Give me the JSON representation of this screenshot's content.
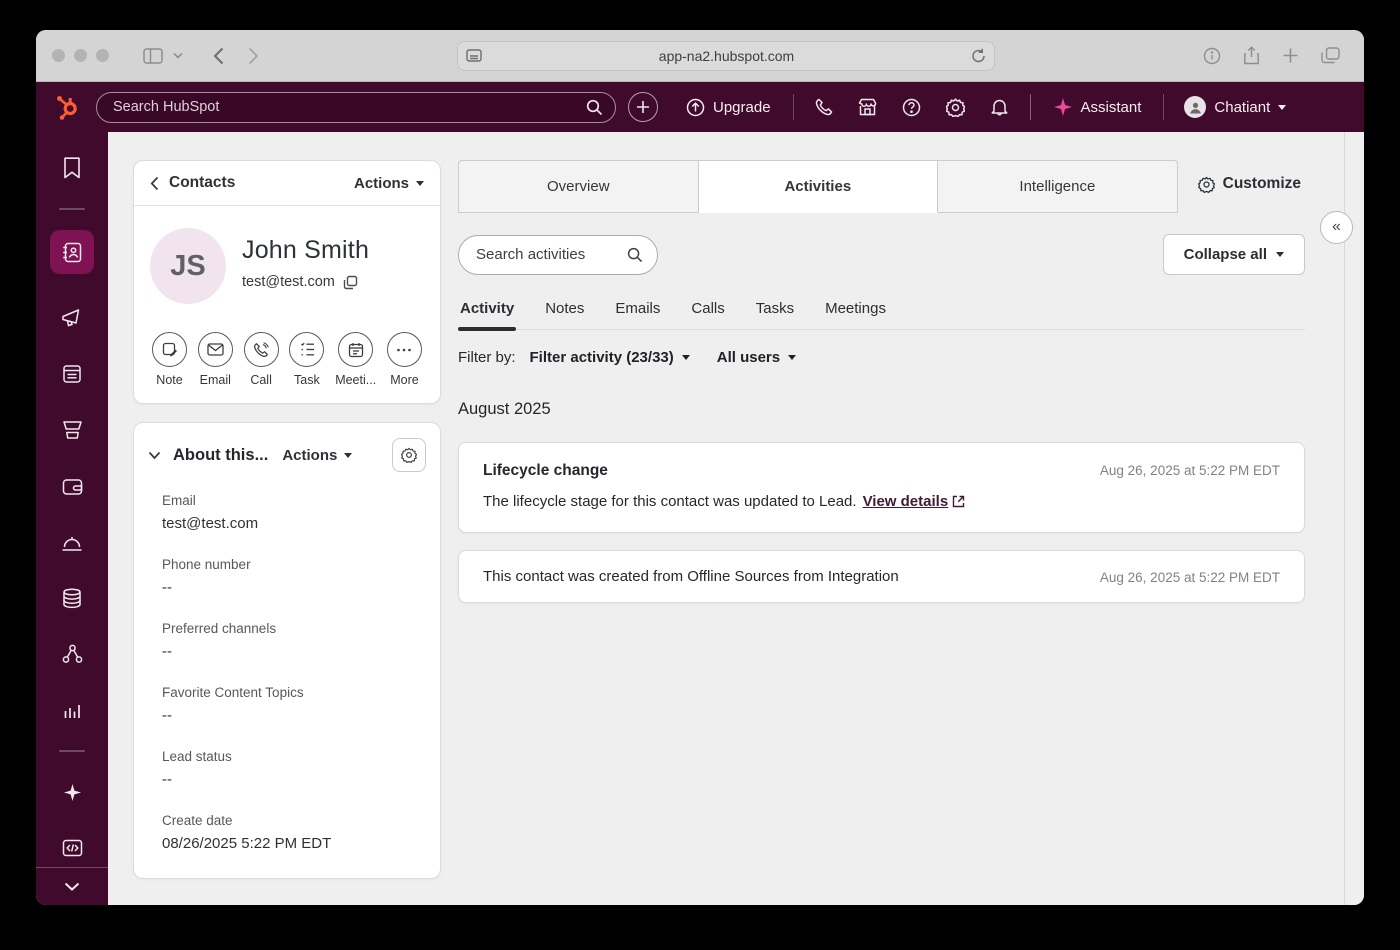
{
  "browser": {
    "url": "app-na2.hubspot.com"
  },
  "topnav": {
    "search_placeholder": "Search HubSpot",
    "upgrade_label": "Upgrade",
    "assistant_label": "Assistant",
    "user_name": "Chatiant"
  },
  "contact_panel": {
    "back_label": "Contacts",
    "actions_label": "Actions",
    "initials": "JS",
    "name": "John Smith",
    "email": "test@test.com",
    "quick_actions": [
      {
        "label": "Note"
      },
      {
        "label": "Email"
      },
      {
        "label": "Call"
      },
      {
        "label": "Task"
      },
      {
        "label": "Meeti..."
      },
      {
        "label": "More"
      }
    ]
  },
  "about_panel": {
    "title": "About this...",
    "actions_label": "Actions",
    "fields": [
      {
        "label": "Email",
        "value": "test@test.com"
      },
      {
        "label": "Phone number",
        "value": "--"
      },
      {
        "label": "Preferred channels",
        "value": "--"
      },
      {
        "label": "Favorite Content Topics",
        "value": "--"
      },
      {
        "label": "Lead status",
        "value": "--"
      },
      {
        "label": "Create date",
        "value": "08/26/2025 5:22 PM EDT"
      }
    ]
  },
  "main": {
    "tabs": [
      {
        "label": "Overview",
        "active": false
      },
      {
        "label": "Activities",
        "active": true
      },
      {
        "label": "Intelligence",
        "active": false
      }
    ],
    "customize_label": "Customize",
    "search_placeholder": "Search activities",
    "collapse_all_label": "Collapse all",
    "subtabs": [
      {
        "label": "Activity",
        "active": true
      },
      {
        "label": "Notes",
        "active": false
      },
      {
        "label": "Emails",
        "active": false
      },
      {
        "label": "Calls",
        "active": false
      },
      {
        "label": "Tasks",
        "active": false
      },
      {
        "label": "Meetings",
        "active": false
      }
    ],
    "filter": {
      "label": "Filter by:",
      "activity_filter": "Filter activity (23/33)",
      "user_filter": "All users"
    },
    "group_heading": "August 2025",
    "activities": [
      {
        "title": "Lifecycle change",
        "timestamp": "Aug 26, 2025 at 5:22 PM EDT",
        "body": "The lifecycle stage for this contact was updated to Lead.",
        "link_label": "View details"
      },
      {
        "title": "This contact was created from Offline Sources from Integration",
        "timestamp": "Aug 26, 2025 at 5:22 PM EDT"
      }
    ]
  },
  "icons": {
    "hubspot-logo": "orange sprocket",
    "search-icon": "magnifier",
    "upgrade-icon": "arrow-up-circle",
    "phone-icon": "handset",
    "marketplace-icon": "storefront",
    "help-icon": "question-circle",
    "settings-icon": "gear",
    "notifications-icon": "bell",
    "assistant-icon": "pink sparkle",
    "copy-icon": "two squares",
    "external-link-icon": "box arrow",
    "collapse-panel-icon": "double chevron left"
  },
  "colors": {
    "brand_orange": "#ff5c35",
    "nav_background": "#400a2d",
    "active_sidebar_item": "#7e1253",
    "assistant_pink": "#ec4b9a",
    "page_background": "#efeff0",
    "link_color": "#401a33"
  }
}
